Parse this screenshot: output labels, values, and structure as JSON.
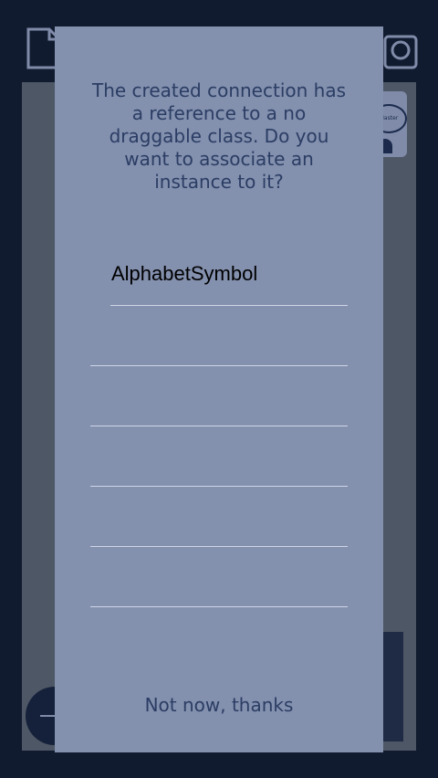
{
  "background": {
    "file_icon": "file-icon",
    "camera_icon": "camera-icon",
    "card_badge_text": "Master"
  },
  "modal": {
    "message": "The created connection has a reference to a no draggable class. Do you want to associate an instance to it?",
    "options": [
      {
        "label": "AlphabetSymbol"
      },
      {
        "label": ""
      },
      {
        "label": ""
      },
      {
        "label": ""
      },
      {
        "label": ""
      },
      {
        "label": ""
      }
    ],
    "dismiss_label": "Not now, thanks"
  },
  "colors": {
    "overlay": "#8390ae",
    "page": "#111b2f",
    "text": "#2b3d64"
  }
}
